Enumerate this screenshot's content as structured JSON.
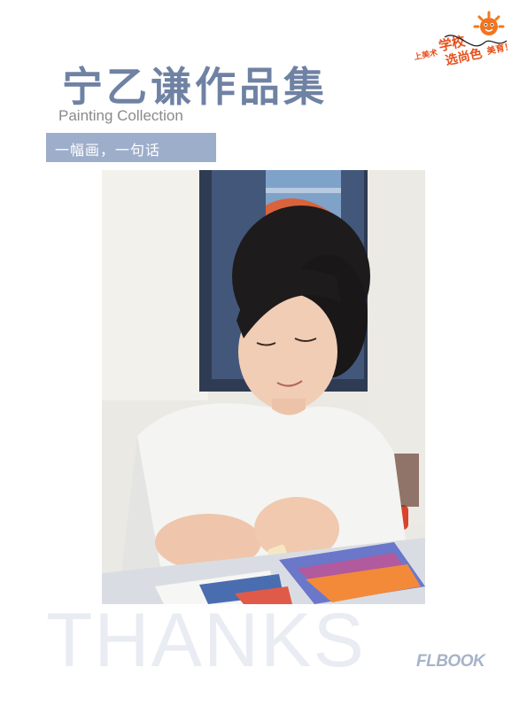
{
  "header": {
    "title": "宁乙谦作品集",
    "subtitle": "Painting Collection",
    "banner_text": "一幅画，一句话"
  },
  "logo": {
    "line1": "上美术",
    "line2": "学校",
    "line3": "选尚色",
    "line4": "美育！",
    "brand_color": "#e8511c"
  },
  "photo": {
    "description_icon": "student-painting-photo"
  },
  "footer": {
    "thanks": "THANKS",
    "flbook": "FLBOOK"
  },
  "colors": {
    "title": "#6f82a3",
    "banner": "#9daecb",
    "thanks": "#e9ecf2",
    "flbook": "#a6b3c8"
  }
}
